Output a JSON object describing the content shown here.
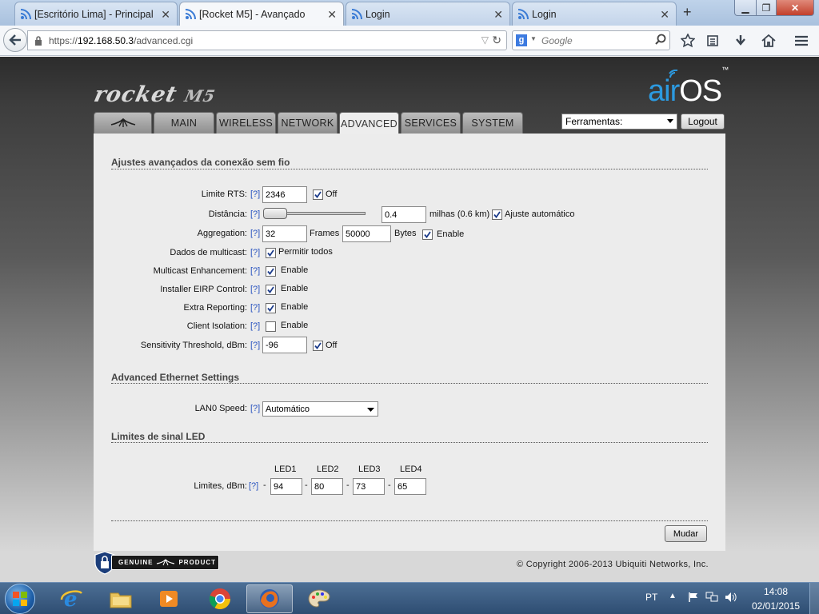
{
  "browser": {
    "tabs": [
      {
        "title": "[Escritório Lima] - Principal"
      },
      {
        "title": "[Rocket M5] - Avançado"
      },
      {
        "title": "Login"
      },
      {
        "title": "Login"
      }
    ],
    "url_prefix": "https://",
    "url_host": "192.168.50.3",
    "url_path": "/advanced.cgi",
    "search_placeholder": "Google"
  },
  "header": {
    "logo_main": "rocket",
    "logo_model": "M5",
    "brand_air": "air",
    "brand_os": "OS",
    "brand_tm": "™",
    "main_tabs": [
      "MAIN",
      "WIRELESS",
      "NETWORK",
      "ADVANCED",
      "SERVICES",
      "SYSTEM"
    ],
    "tools_label": "Ferramentas:",
    "logout_label": "Logout"
  },
  "wireless_section": {
    "title": "Ajustes avançados da conexão sem fio",
    "help": "[?]",
    "rts": {
      "label": "Limite RTS:",
      "value": "2346",
      "off_label": "Off",
      "off_checked": true
    },
    "distance": {
      "label": "Distância:",
      "value": "0.4",
      "units": "milhas (0.6 km)",
      "auto_label": "Ajuste automático",
      "auto_checked": true,
      "slider_level": 0.05
    },
    "aggregation": {
      "label": "Aggregation:",
      "frames_value": "32",
      "frames_label": "Frames",
      "bytes_value": "50000",
      "bytes_label": "Bytes",
      "enable_label": "Enable",
      "enable_checked": true
    },
    "multicast_data": {
      "label": "Dados de multicast:",
      "option_label": "Permitir todos",
      "checked": true
    },
    "multicast_enhancement": {
      "label": "Multicast Enhancement:",
      "option_label": "Enable",
      "checked": true
    },
    "installer_eirp": {
      "label": "Installer EIRP Control:",
      "option_label": "Enable",
      "checked": true
    },
    "extra_reporting": {
      "label": "Extra Reporting:",
      "option_label": "Enable",
      "checked": true
    },
    "client_isolation": {
      "label": "Client Isolation:",
      "option_label": "Enable",
      "checked": false
    },
    "sensitivity": {
      "label": "Sensitivity Threshold, dBm:",
      "value": "-96",
      "off_label": "Off",
      "off_checked": true
    }
  },
  "ethernet_section": {
    "title": "Advanced Ethernet Settings",
    "lan0": {
      "label": "LAN0 Speed:",
      "value": "Automático"
    }
  },
  "led_section": {
    "title": "Limites de sinal LED",
    "label": "Limites, dBm:",
    "headers": [
      "LED1",
      "LED2",
      "LED3",
      "LED4"
    ],
    "values": [
      "94",
      "80",
      "73",
      "65"
    ],
    "separator": "-"
  },
  "footer": {
    "apply_label": "Mudar",
    "genuine_text_left": "GENUINE",
    "genuine_text_right": "PRODUCT",
    "copyright": "© Copyright 2006-2013 Ubiquiti Networks, Inc."
  },
  "taskbar": {
    "language": "PT",
    "time": "14:08",
    "date": "02/01/2015"
  },
  "colors": {
    "brand_blue": "#2c9ae0",
    "help_link": "#2b55c0",
    "panel_bg": "#ececec"
  }
}
